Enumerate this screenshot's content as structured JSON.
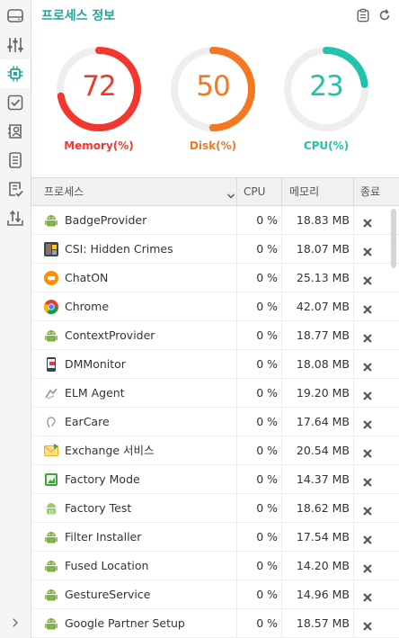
{
  "header": {
    "title": "프로세스 정보",
    "icons": [
      "clipboard-icon",
      "refresh-icon"
    ]
  },
  "sidebar": {
    "items": [
      {
        "icon": "storage-icon"
      },
      {
        "icon": "sliders-icon"
      },
      {
        "icon": "chip-icon",
        "active": true
      },
      {
        "icon": "checkbox-icon"
      },
      {
        "icon": "contact-icon"
      },
      {
        "icon": "document-icon"
      },
      {
        "icon": "checklist-icon"
      },
      {
        "icon": "transfer-icon"
      }
    ],
    "expand_icon": "chevron-right-icon"
  },
  "gauges": [
    {
      "key": "memory",
      "value": "72",
      "percent": 72,
      "label": "Memory(%)",
      "color": "#f2382e"
    },
    {
      "key": "disk",
      "value": "50",
      "percent": 50,
      "label": "Disk(%)",
      "color": "#f5771f"
    },
    {
      "key": "cpu",
      "value": "23",
      "percent": 23,
      "label": "CPU(%)",
      "color": "#22c3aa"
    }
  ],
  "table": {
    "columns": {
      "process": "프로세스",
      "cpu": "CPU",
      "memory": "메모리",
      "end": "종료"
    },
    "rows": [
      {
        "name": "BadgeProvider",
        "cpu": "0 %",
        "mem": "18.83 MB",
        "icon": "android-icon"
      },
      {
        "name": "CSI: Hidden Crimes",
        "cpu": "0 %",
        "mem": "18.07 MB",
        "icon": "game-icon"
      },
      {
        "name": "ChatON",
        "cpu": "0 %",
        "mem": "25.13 MB",
        "icon": "chat-icon"
      },
      {
        "name": "Chrome",
        "cpu": "0 %",
        "mem": "42.07 MB",
        "icon": "chrome-icon"
      },
      {
        "name": "ContextProvider",
        "cpu": "0 %",
        "mem": "18.77 MB",
        "icon": "android-icon"
      },
      {
        "name": "DMMonitor",
        "cpu": "0 %",
        "mem": "18.08 MB",
        "icon": "phone-icon"
      },
      {
        "name": "ELM Agent",
        "cpu": "0 %",
        "mem": "19.20 MB",
        "icon": "agent-icon"
      },
      {
        "name": "EarCare",
        "cpu": "0 %",
        "mem": "17.64 MB",
        "icon": "ear-icon"
      },
      {
        "name": "Exchange 서비스",
        "cpu": "0 %",
        "mem": "20.54 MB",
        "icon": "mail-icon"
      },
      {
        "name": "Factory Mode",
        "cpu": "0 %",
        "mem": "14.37 MB",
        "icon": "factory-icon"
      },
      {
        "name": "Factory Test",
        "cpu": "0 %",
        "mem": "18.62 MB",
        "icon": "android-test-icon"
      },
      {
        "name": "Filter Installer",
        "cpu": "0 %",
        "mem": "17.54 MB",
        "icon": "android-icon"
      },
      {
        "name": "Fused Location",
        "cpu": "0 %",
        "mem": "14.20 MB",
        "icon": "android-icon"
      },
      {
        "name": "GestureService",
        "cpu": "0 %",
        "mem": "14.96 MB",
        "icon": "android-icon"
      },
      {
        "name": "Google Partner Setup",
        "cpu": "0 %",
        "mem": "18.57 MB",
        "icon": "android-icon"
      }
    ]
  }
}
